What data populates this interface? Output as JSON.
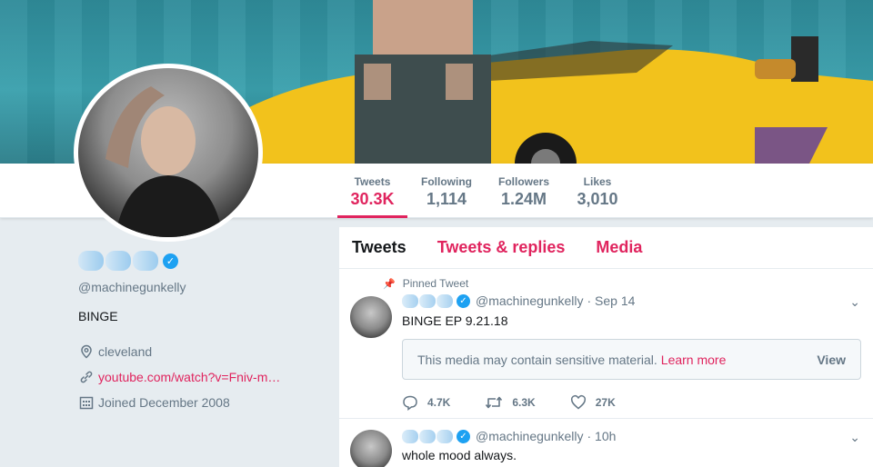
{
  "stats": [
    {
      "label": "Tweets",
      "value": "30.3K"
    },
    {
      "label": "Following",
      "value": "1,114"
    },
    {
      "label": "Followers",
      "value": "1.24M"
    },
    {
      "label": "Likes",
      "value": "3,010"
    }
  ],
  "profile": {
    "handle": "@machinegunkelly",
    "bio": "BINGE",
    "location": "cleveland",
    "website": "youtube.com/watch?v=Fniv-m…",
    "joined": "Joined December 2008"
  },
  "tabs": [
    "Tweets",
    "Tweets & replies",
    "Media"
  ],
  "tweets": [
    {
      "pinned_label": "Pinned Tweet",
      "handle": "@machinegunkelly",
      "time": "· Sep 14",
      "text": "BINGE EP 9.21.18",
      "sensitive_text": "This media may contain sensitive material.",
      "learn_more": "Learn more",
      "view": "View",
      "replies": "4.7K",
      "retweets": "6.3K",
      "likes": "27K"
    },
    {
      "handle": "@machinegunkelly",
      "time": "· 10h",
      "text": "whole mood always."
    }
  ],
  "colors": {
    "accent": "#e0245e",
    "verified": "#1da1f2",
    "muted": "#657786",
    "background": "#e6ecf0"
  },
  "icons": {
    "verified": "verified-badge-icon",
    "location": "location-pin-icon",
    "link": "link-icon",
    "calendar": "calendar-icon",
    "pin": "pin-icon",
    "reply": "reply-icon",
    "retweet": "retweet-icon",
    "like": "heart-icon",
    "caret": "chevron-down-icon"
  }
}
